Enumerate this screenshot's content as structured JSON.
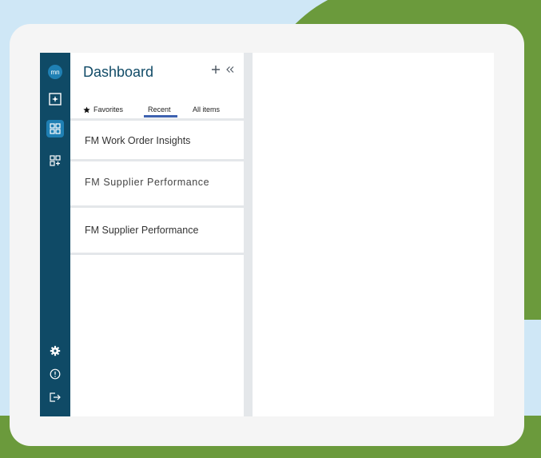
{
  "app": {
    "panel_title": "Dashboard",
    "logo_text": "mn"
  },
  "tabs": [
    {
      "label": "Favorites",
      "active": false
    },
    {
      "label": "Recent",
      "active": true
    },
    {
      "label": "All items",
      "active": false
    }
  ],
  "items": [
    {
      "label": "FM Work Order Insights"
    },
    {
      "label": "FM Supplier Performance"
    },
    {
      "label": "FM Supplier Performance"
    }
  ],
  "rail": {
    "top_icons": [
      "logo-icon",
      "sparkle-icon",
      "dashboard-grid-icon",
      "add-widget-icon"
    ],
    "bottom_icons": [
      "settings-icon",
      "info-icon",
      "logout-icon"
    ]
  },
  "colors": {
    "rail": "#0f4a66",
    "accent": "#1f80b4",
    "tab_underline": "#3e62b0",
    "title": "#114b67"
  }
}
